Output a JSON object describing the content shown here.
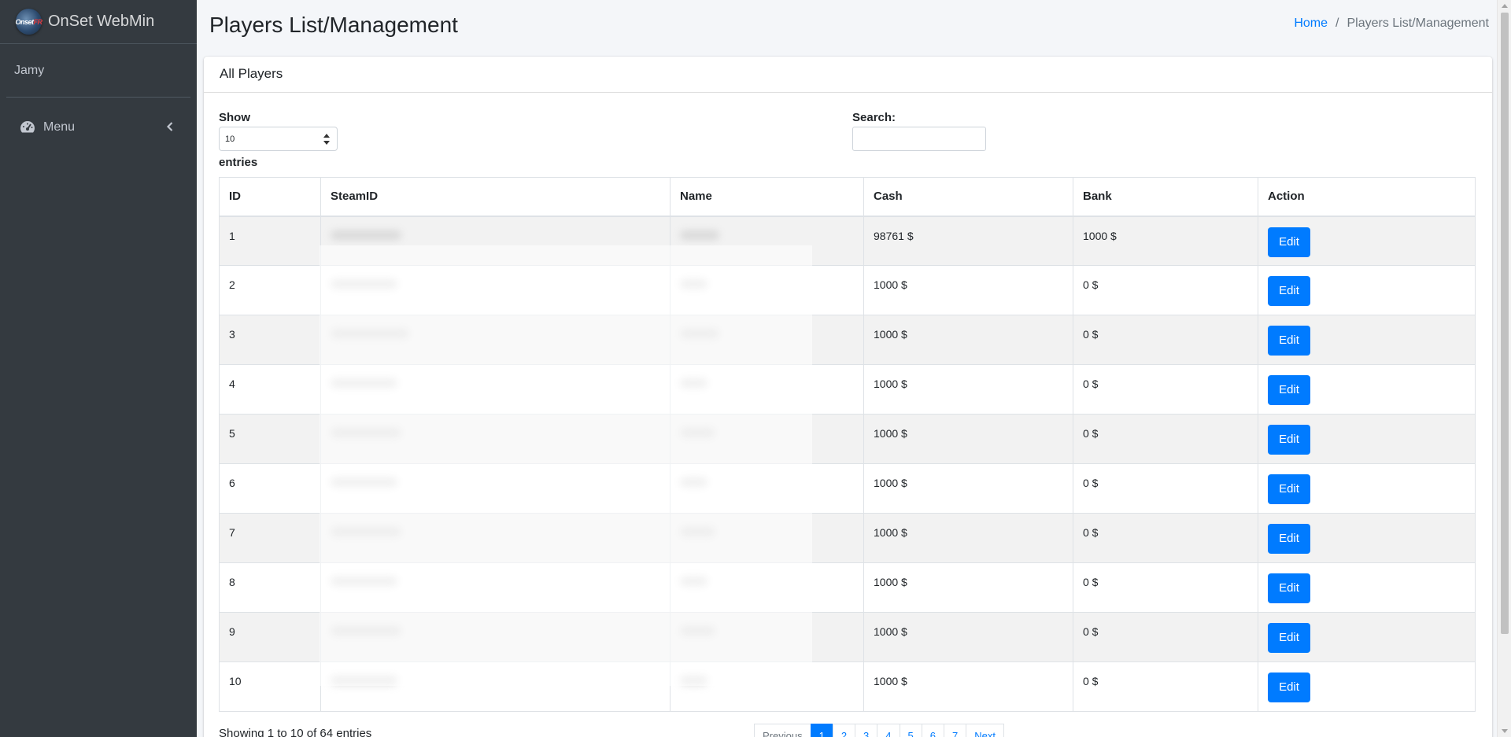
{
  "app": {
    "brand": "OnSet WebMin",
    "logo_text_a": "Onset",
    "logo_text_b": "FR"
  },
  "sidebar": {
    "user": "Jamy",
    "menu_label": "Menu"
  },
  "header": {
    "title": "Players List/Management"
  },
  "breadcrumb": {
    "home": "Home",
    "separator": "/",
    "current": "Players List/Management"
  },
  "card": {
    "title": "All Players"
  },
  "controls": {
    "show_label": "Show",
    "length_value": "10",
    "entries_label": "entries",
    "search_label": "Search:",
    "search_value": ""
  },
  "table": {
    "columns": [
      "ID",
      "SteamID",
      "Name",
      "Cash",
      "Bank",
      "Action"
    ],
    "rows": [
      {
        "id": "1",
        "cash": "98761 $",
        "bank": "1000 $",
        "action": "Edit"
      },
      {
        "id": "2",
        "cash": "1000 $",
        "bank": "0 $",
        "action": "Edit"
      },
      {
        "id": "3",
        "cash": "1000 $",
        "bank": "0 $",
        "action": "Edit"
      },
      {
        "id": "4",
        "cash": "1000 $",
        "bank": "0 $",
        "action": "Edit"
      },
      {
        "id": "5",
        "cash": "1000 $",
        "bank": "0 $",
        "action": "Edit"
      },
      {
        "id": "6",
        "cash": "1000 $",
        "bank": "0 $",
        "action": "Edit"
      },
      {
        "id": "7",
        "cash": "1000 $",
        "bank": "0 $",
        "action": "Edit"
      },
      {
        "id": "8",
        "cash": "1000 $",
        "bank": "0 $",
        "action": "Edit"
      },
      {
        "id": "9",
        "cash": "1000 $",
        "bank": "0 $",
        "action": "Edit"
      },
      {
        "id": "10",
        "cash": "1000 $",
        "bank": "0 $",
        "action": "Edit"
      }
    ]
  },
  "footer": {
    "info": "Showing 1 to 10 of 64 entries"
  },
  "pagination": {
    "previous": "Previous",
    "pages": [
      "1",
      "2",
      "3",
      "4",
      "5",
      "6",
      "7"
    ],
    "next": "Next"
  }
}
